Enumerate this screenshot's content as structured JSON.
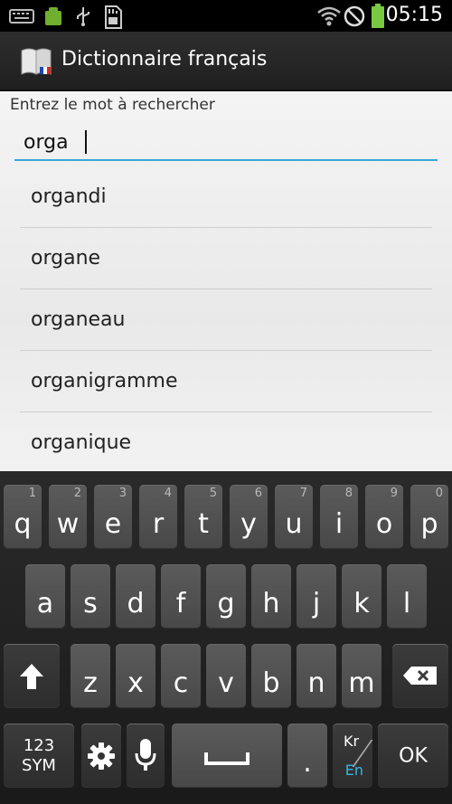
{
  "status": {
    "time": "05:15",
    "icons": [
      "keyboard-icon",
      "android-icon",
      "usb-icon",
      "sd-card-icon",
      "wifi-icon",
      "no-signal-icon",
      "battery-icon"
    ]
  },
  "app": {
    "title": "Dictionnaire français",
    "icon": "dictionary-book-icon"
  },
  "search": {
    "prompt": "Entrez le mot à rechercher",
    "value": "orga"
  },
  "suggestions": [
    "organdi",
    "organe",
    "organeau",
    "organigramme",
    "organique"
  ],
  "keyboard": {
    "row1": [
      {
        "k": "q",
        "n": "1"
      },
      {
        "k": "w",
        "n": "2"
      },
      {
        "k": "e",
        "n": "3"
      },
      {
        "k": "r",
        "n": "4"
      },
      {
        "k": "t",
        "n": "5"
      },
      {
        "k": "y",
        "n": "6"
      },
      {
        "k": "u",
        "n": "7"
      },
      {
        "k": "i",
        "n": "8"
      },
      {
        "k": "o",
        "n": "9"
      },
      {
        "k": "p",
        "n": "0"
      }
    ],
    "row2": [
      "a",
      "s",
      "d",
      "f",
      "g",
      "h",
      "j",
      "k",
      "l"
    ],
    "row3": [
      "z",
      "x",
      "c",
      "v",
      "b",
      "n",
      "m"
    ],
    "sym_label_1": "123",
    "sym_label_2": "SYM",
    "period": ".",
    "ok": "OK",
    "lang_top": "Kr",
    "lang_bottom": "En",
    "accent_color": "#33b5e5"
  }
}
